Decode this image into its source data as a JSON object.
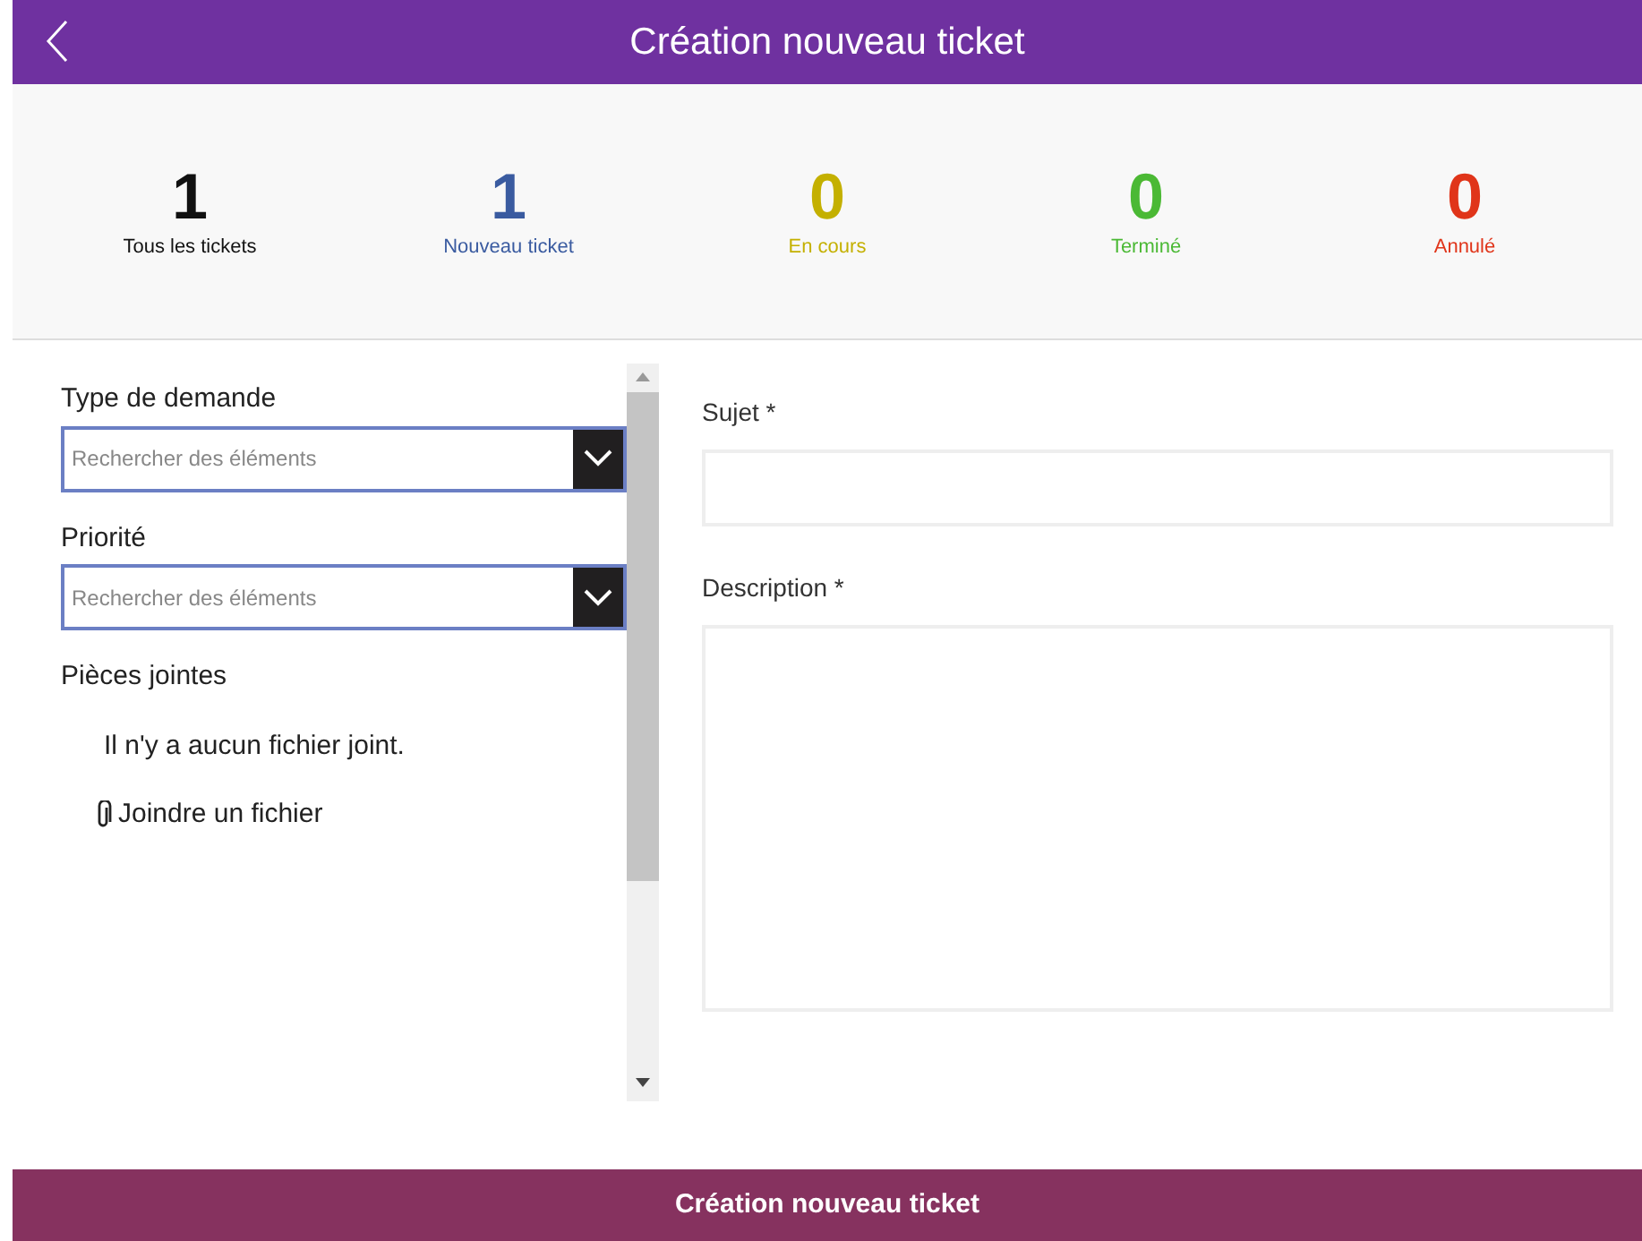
{
  "header": {
    "title": "Création nouveau ticket"
  },
  "stats": [
    {
      "count": "1",
      "label": "Tous les tickets",
      "color": "#111111"
    },
    {
      "count": "1",
      "label": "Nouveau ticket",
      "color": "#3a5ba0"
    },
    {
      "count": "0",
      "label": "En cours",
      "color": "#c4b000"
    },
    {
      "count": "0",
      "label": "Terminé",
      "color": "#4bb935"
    },
    {
      "count": "0",
      "label": "Annulé",
      "color": "#e0351a"
    }
  ],
  "left_form": {
    "dropdowns": [
      {
        "label": "Type de demande",
        "placeholder": "Rechercher des éléments"
      },
      {
        "label": "Priorité",
        "placeholder": "Rechercher des éléments"
      }
    ],
    "attachments": {
      "label": "Pièces jointes",
      "empty_message": "Il n'y a aucun fichier joint.",
      "attach_link": "Joindre un fichier"
    }
  },
  "right_form": {
    "fields": [
      {
        "label": "Sujet *",
        "kind": "single"
      },
      {
        "label": "Description *",
        "kind": "multi"
      }
    ]
  },
  "footer": {
    "button": "Création nouveau ticket"
  }
}
